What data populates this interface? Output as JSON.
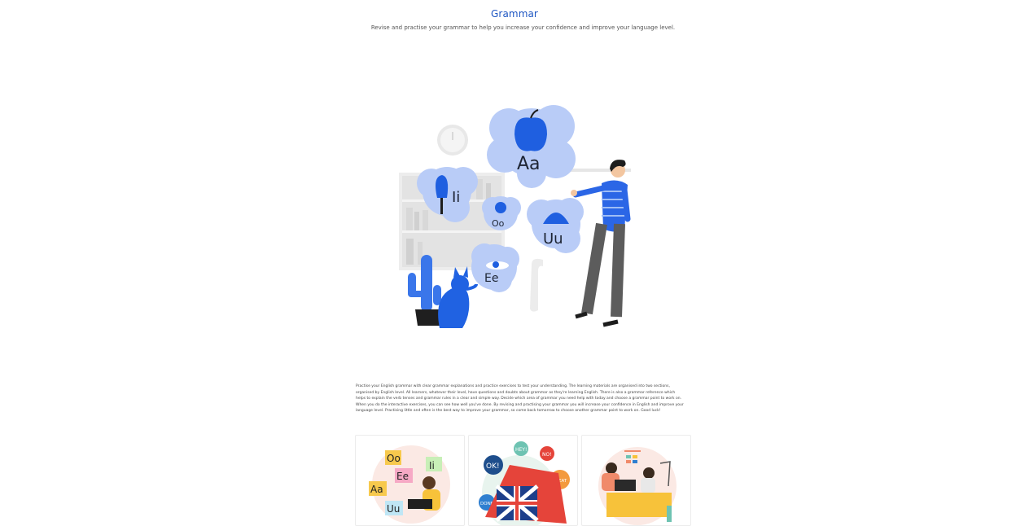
{
  "header": {
    "title": "Grammar",
    "subtitle": "Revise and practise your grammar to help you increase your confidence and improve your language level."
  },
  "hero_illustration": {
    "letters": [
      "Aa",
      "Ii",
      "Oo",
      "Uu",
      "Ee"
    ],
    "colors": {
      "blue": "#2a6ae8",
      "light_blue": "#b9ccf7",
      "grey": "#5c5c5c",
      "light_grey": "#e6e6e6"
    }
  },
  "intro_text": "Practise your English grammar with clear grammar explanations and practice exercises to test your understanding. The learning materials are organised into two sections, organised by English level. All learners, whatever their level, have questions and doubts about grammar as they're learning English. There is also a grammar reference which helps to explain the verb tenses and grammar rules in a clear and simple way. Decide which area of grammar you need help with today and choose a grammar point to work on. When you do the interactive exercises, you can see how well you've done. By revising and practising your grammar you will increase your confidence in English and improve your language level. Practising little and often is the best way to improve your grammar, so come back tomorrow to choose another grammar point to work on. Good luck!",
  "cards": [
    {
      "letters": [
        "Oo",
        "Ee",
        "Ii",
        "Aa",
        "Uu"
      ]
    },
    {
      "bubbles": [
        "HEY!",
        "NO!",
        "OK!",
        "GREAT",
        "DONE"
      ]
    },
    {
      "icons": [
        "desk",
        "lamp",
        "laptop"
      ]
    }
  ]
}
